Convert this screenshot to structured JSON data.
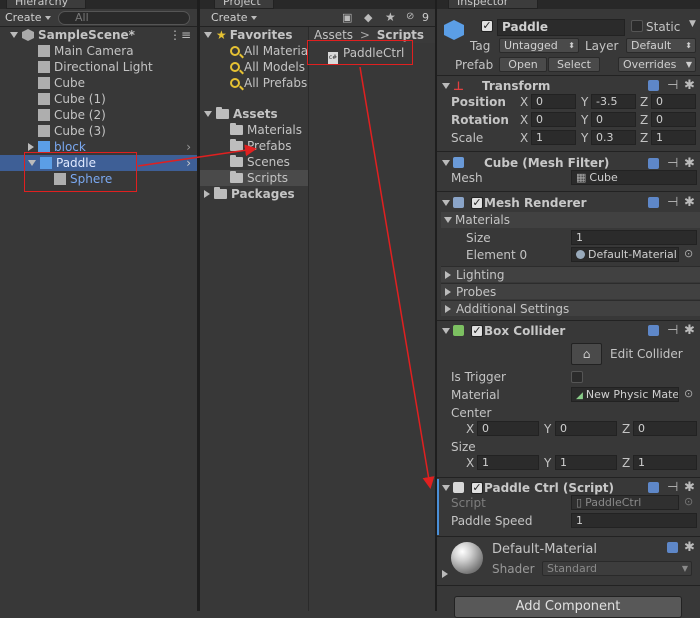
{
  "hierarchy": {
    "tab": "Hierarchy",
    "create": "Create",
    "search_placeholder": "All",
    "scene": "SampleScene*",
    "items": [
      "Main Camera",
      "Directional Light",
      "Cube",
      "Cube (1)",
      "Cube (2)",
      "Cube (3)",
      "block",
      "Paddle",
      "Sphere"
    ]
  },
  "project": {
    "tab": "Project",
    "create": "Create",
    "badge": "9",
    "favorites": "Favorites",
    "fav_items": [
      "All Materia",
      "All Models",
      "All Prefabs"
    ],
    "assets": "Assets",
    "asset_folders": [
      "Materials",
      "Prefabs",
      "Scenes",
      "Scripts"
    ],
    "packages": "Packages",
    "breadcrumb": [
      "Assets",
      "Scripts"
    ],
    "file": "PaddleCtrl"
  },
  "inspector": {
    "tab": "Inspector",
    "object_name": "Paddle",
    "static_label": "Static",
    "tag_label": "Tag",
    "tag_value": "Untagged",
    "layer_label": "Layer",
    "layer_value": "Default",
    "prefab_label": "Prefab",
    "open_btn": "Open",
    "select_btn": "Select",
    "overrides_btn": "Overrides",
    "transform": {
      "title": "Transform",
      "position_label": "Position",
      "position": [
        "0",
        "-3.5",
        "0"
      ],
      "rotation_label": "Rotation",
      "rotation": [
        "0",
        "0",
        "0"
      ],
      "scale_label": "Scale",
      "scale": [
        "1",
        "0.3",
        "1"
      ],
      "axes": [
        "X",
        "Y",
        "Z"
      ]
    },
    "mesh_filter": {
      "title": "Cube (Mesh Filter)",
      "mesh_label": "Mesh",
      "mesh_value": "Cube"
    },
    "mesh_renderer": {
      "title": "Mesh Renderer",
      "materials_label": "Materials",
      "size_label": "Size",
      "size_value": "1",
      "element_label": "Element 0",
      "element_value": "Default-Material",
      "lighting": "Lighting",
      "probes": "Probes",
      "additional": "Additional Settings"
    },
    "box_collider": {
      "title": "Box Collider",
      "edit_label": "Edit Collider",
      "is_trigger_label": "Is Trigger",
      "material_label": "Material",
      "material_value": "New Physic Mate",
      "center_label": "Center",
      "center": [
        "0",
        "0",
        "0"
      ],
      "size_label": "Size",
      "size": [
        "1",
        "1",
        "1"
      ]
    },
    "script": {
      "title": "Paddle Ctrl (Script)",
      "script_label": "Script",
      "script_value": "PaddleCtrl",
      "speed_label": "Paddle Speed",
      "speed_value": "1"
    },
    "material": {
      "name": "Default-Material",
      "shader_label": "Shader",
      "shader_value": "Standard"
    },
    "add_component": "Add Component"
  }
}
